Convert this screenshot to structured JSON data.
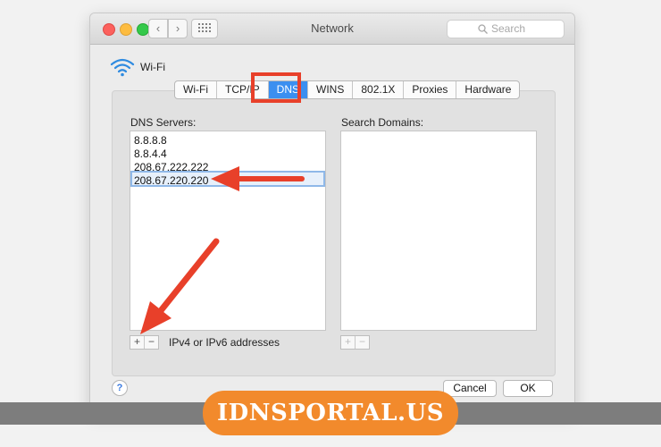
{
  "window": {
    "title": "Network",
    "search_placeholder": "Search"
  },
  "interface": {
    "name": "Wi-Fi",
    "icon": "wifi-icon"
  },
  "tabs": [
    {
      "label": "Wi-Fi",
      "active": false
    },
    {
      "label": "TCP/IP",
      "active": false
    },
    {
      "label": "DNS",
      "active": true
    },
    {
      "label": "WINS",
      "active": false
    },
    {
      "label": "802.1X",
      "active": false
    },
    {
      "label": "Proxies",
      "active": false
    },
    {
      "label": "Hardware",
      "active": false
    }
  ],
  "dns_servers": {
    "label": "DNS Servers:",
    "items": [
      "8.8.8.8",
      "8.8.4.4",
      "208.67.222.222",
      "208.67.220.220"
    ],
    "selected": "208.67.220.220",
    "add": "+",
    "remove": "−",
    "hint": "IPv4 or IPv6 addresses"
  },
  "search_domains": {
    "label": "Search Domains:",
    "items": [],
    "add": "+",
    "remove": "−"
  },
  "buttons": {
    "help": "?",
    "cancel": "Cancel",
    "ok": "OK"
  },
  "watermark": {
    "text": "IDNSPORTAL.US"
  },
  "colors": {
    "annotation": "#e8402a",
    "accent": "#3b8ff0",
    "watermark": "#f28a2c"
  }
}
